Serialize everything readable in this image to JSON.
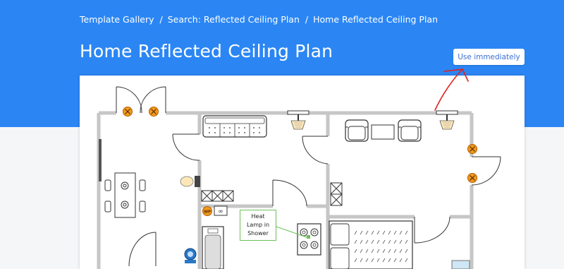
{
  "breadcrumb": {
    "gallery": "Template Gallery",
    "separator": "/",
    "search": "Search:  Reflected Ceiling Plan",
    "current": "Home Reflected Ceiling Plan"
  },
  "page": {
    "title": "Home Reflected Ceiling Plan"
  },
  "actions": {
    "use_label": "Use immediately"
  },
  "plan": {
    "wp_label": "WP",
    "callout": {
      "line1": "Heat",
      "line2": "Lamp in",
      "line3": "Shower"
    }
  },
  "colors": {
    "header": "#2b86f4",
    "annotation": "#e0201e",
    "wall": "#c6c6c6",
    "callout_border": "#6cbf5a"
  },
  "icons": [
    "ceiling-light-icon",
    "light-fixture-icon",
    "door-swing-icon",
    "sofa-icon",
    "stove-icon",
    "toilet-icon",
    "bathtub-icon",
    "bed-icon",
    "dining-table-icon"
  ]
}
